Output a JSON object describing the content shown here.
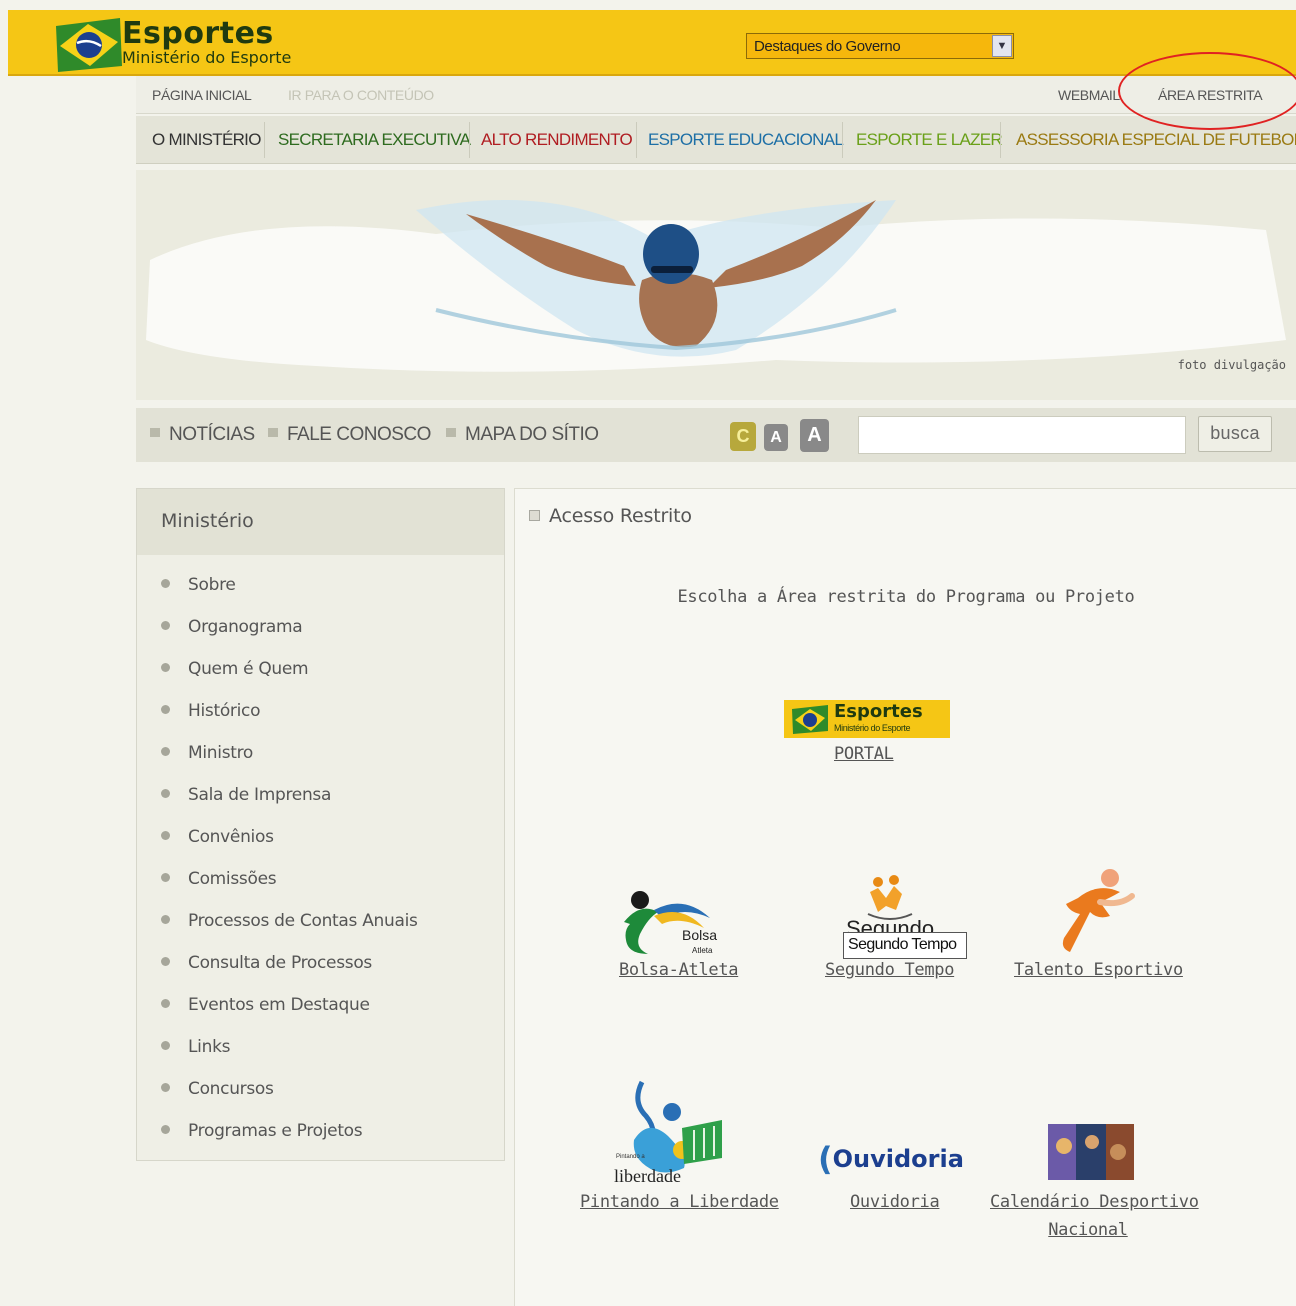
{
  "header": {
    "brand_title": "Esportes",
    "brand_subtitle": "Ministério do Esporte",
    "gov_select_value": "Destaques do Governo"
  },
  "util_links": {
    "home": "PÁGINA INICIAL",
    "skip": "IR PARA O CONTEÚDO",
    "webmail": "WEBMAIL",
    "restricted": "ÁREA RESTRITA"
  },
  "nav": [
    {
      "label": "O MINISTÉRIO",
      "color": "#333333"
    },
    {
      "label": "SECRETARIA EXECUTIVA",
      "color": "#2e6b1f"
    },
    {
      "label": "ALTO RENDIMENTO",
      "color": "#b01d22"
    },
    {
      "label": "ESPORTE EDUCACIONAL",
      "color": "#1d6fa6"
    },
    {
      "label": "ESPORTE E LAZER",
      "color": "#6aa019"
    },
    {
      "label": "ASSESSORIA ESPECIAL DE FUTEBOL",
      "color": "#9a7a12"
    }
  ],
  "hero": {
    "credit": "foto divulgação"
  },
  "bar2": {
    "news": "NOTÍCIAS",
    "contact": "FALE CONOSCO",
    "sitemap": "MAPA DO SÍTIO",
    "contrast": "C",
    "font_small": "A",
    "font_large": "A",
    "search_placeholder": "",
    "search_button": "busca"
  },
  "sidebar": {
    "title": "Ministério",
    "items": [
      "Sobre",
      "Organograma",
      "Quem é Quem",
      "Histórico",
      "Ministro",
      "Sala de Imprensa",
      "Convênios",
      "Comissões",
      "Processos de Contas Anuais",
      "Consulta de Processos",
      "Eventos em Destaque",
      "Links",
      "Concursos",
      "Programas e Projetos"
    ]
  },
  "main": {
    "title": "Acesso Restrito",
    "intro": "Escolha a Área restrita do Programa ou Projeto",
    "portal_logo_title": "Esportes",
    "portal_logo_subtitle": "Ministério do Esporte",
    "portal": "PORTAL",
    "bolsa": "Bolsa-Atleta",
    "bolsa_logo_top": "Bolsa",
    "bolsa_logo_bottom": "Atleta",
    "segundo": "Segundo Tempo",
    "segundo_logo": "Segundo",
    "segundo_tooltip": "Segundo Tempo",
    "talento": "Talento Esportivo",
    "pintando": "Pintando a Liberdade",
    "pintando_logo_small": "Pintando a",
    "pintando_logo": "liberdade",
    "ouvidoria": "Ouvidoria",
    "ouvidoria_logo": "Ouvidoria",
    "calendario_1": "Calendário Desportivo",
    "calendario_2": "Nacional"
  },
  "colors": {
    "top_bar": "#f5c615",
    "highlight_circle": "#e02222"
  }
}
